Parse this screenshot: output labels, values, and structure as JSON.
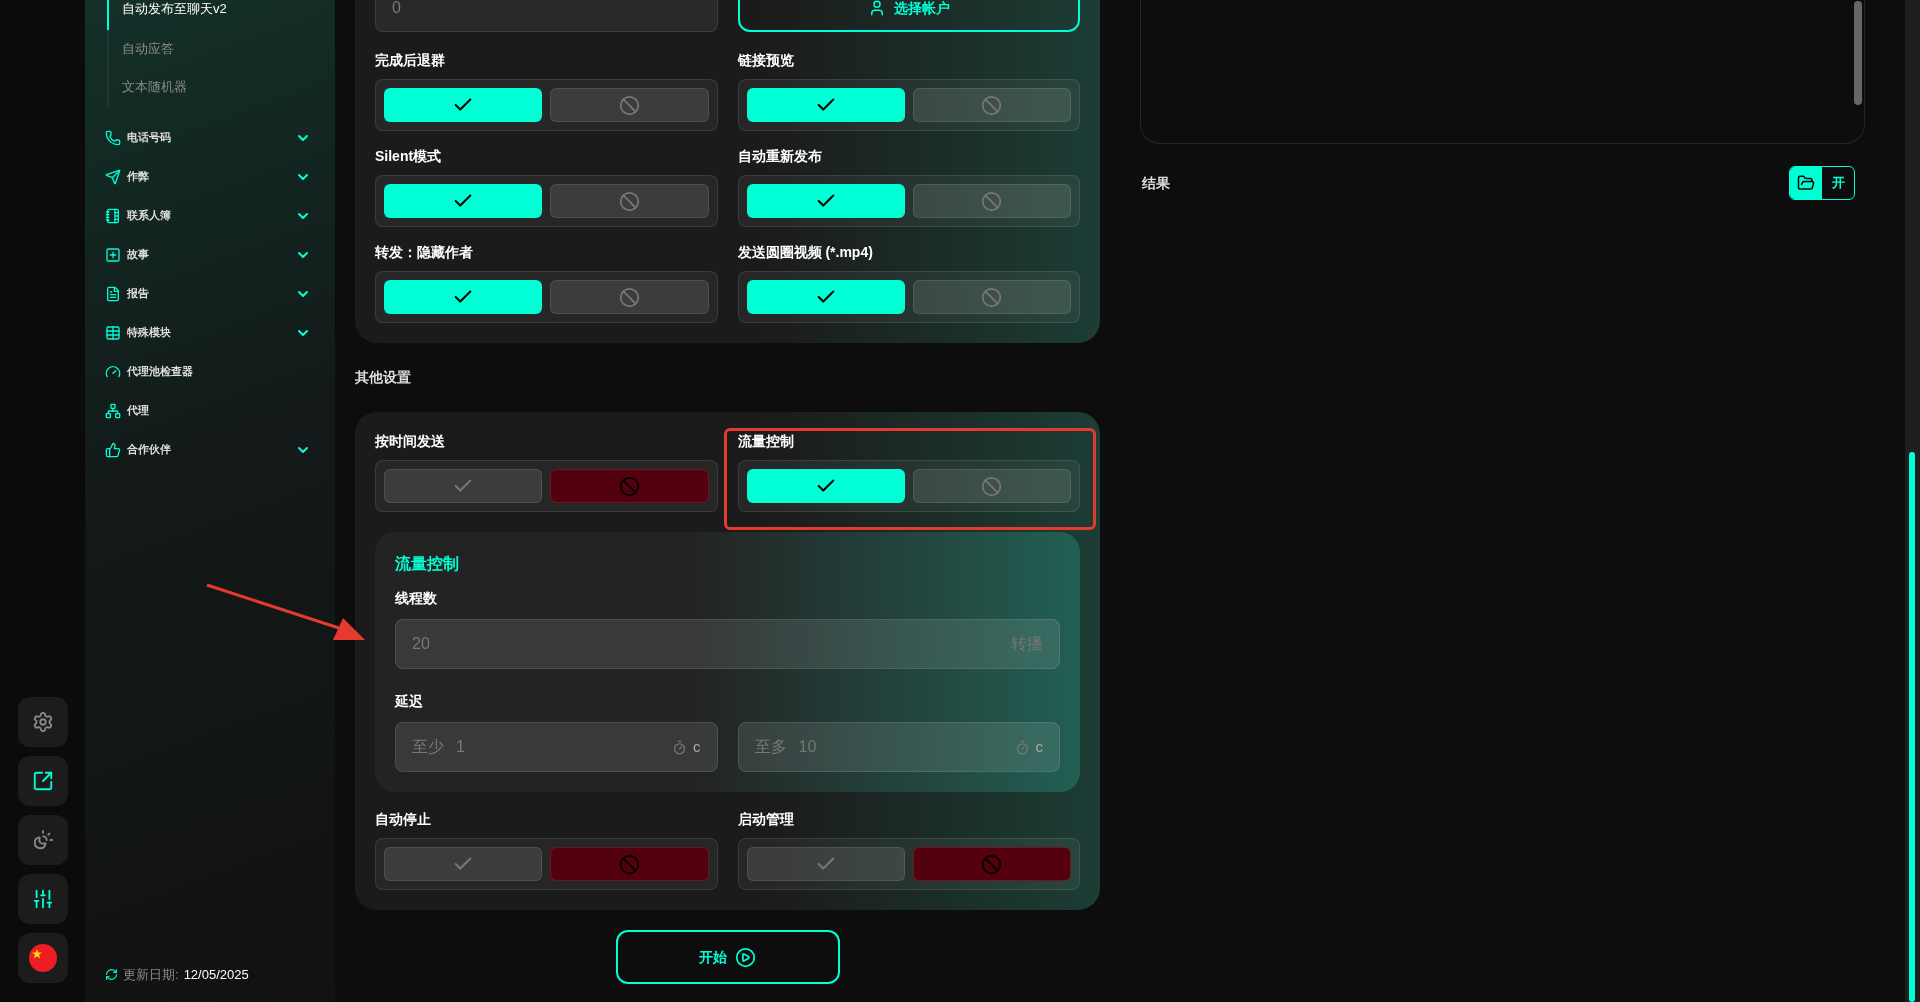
{
  "rail": [
    {
      "kind": "settings",
      "highlighted": false
    },
    {
      "kind": "external",
      "highlighted": true
    },
    {
      "kind": "theme",
      "highlighted": false
    },
    {
      "kind": "sliders",
      "highlighted": true
    },
    {
      "kind": "flag",
      "highlighted": false
    }
  ],
  "sidebar": {
    "subitems": [
      {
        "label": "自动发布至聊天v2",
        "selected": true
      },
      {
        "label": "自动应答",
        "selected": false
      },
      {
        "label": "文本随机器",
        "selected": false
      }
    ],
    "items": [
      {
        "kind": "phone",
        "label": "电话号码",
        "expandable": true
      },
      {
        "kind": "send",
        "label": "作弊",
        "expandable": true
      },
      {
        "kind": "notebook",
        "label": "联系人簿",
        "expandable": true
      },
      {
        "kind": "plus",
        "label": "故事",
        "expandable": true
      },
      {
        "kind": "report",
        "label": "报告",
        "expandable": true
      },
      {
        "kind": "table",
        "label": "特殊模块",
        "expandable": true
      },
      {
        "kind": "gauge",
        "label": "代理池检查器",
        "expandable": false
      },
      {
        "kind": "network",
        "label": "代理",
        "expandable": false
      },
      {
        "kind": "thumb",
        "label": "合作伙伴",
        "expandable": true
      }
    ],
    "update_label": "更新日期:",
    "update_date": "12/05/2025"
  },
  "main": {
    "top_input": {
      "placeholder": "0"
    },
    "account_button": "选择帐户",
    "toggles": [
      {
        "label": "完成后退群",
        "on": true
      },
      {
        "label": "链接预览",
        "on": true
      },
      {
        "label": "Silent模式",
        "on": true
      },
      {
        "label": "自动重新发布",
        "on": true
      },
      {
        "label": "转发：隐藏作者",
        "on": true
      },
      {
        "label": "发送圆圈视频 (*.mp4)",
        "on": true
      }
    ],
    "other_title": "其他设置",
    "other_toggles": [
      {
        "label": "按时间发送",
        "on": false
      },
      {
        "label": "流量控制",
        "on": true
      }
    ],
    "flow": {
      "title": "流量控制",
      "threads_label": "线程数",
      "threads": {
        "placeholder": "20",
        "suffix": "转播"
      },
      "delay_label": "延迟",
      "delay": [
        {
          "prefix": "至少",
          "placeholder": "1",
          "unit": "c"
        },
        {
          "prefix": "至多",
          "placeholder": "10",
          "unit": "c"
        }
      ]
    },
    "bottom_toggles": [
      {
        "label": "自动停止",
        "on": false
      },
      {
        "label": "启动管理",
        "on": false
      }
    ],
    "start_button": "开始"
  },
  "results": {
    "title": "结果",
    "open_button": "开"
  }
}
